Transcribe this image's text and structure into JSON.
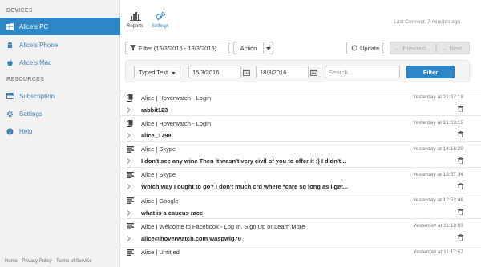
{
  "sidebar": {
    "devices_heading": "DEVICES",
    "devices": [
      {
        "label": "Alice's PC",
        "icon": "windows-icon",
        "active": true
      },
      {
        "label": "Alice's Phone",
        "icon": "android-icon",
        "active": false
      },
      {
        "label": "Alice's Mac",
        "icon": "apple-icon",
        "active": false
      }
    ],
    "resources_heading": "RESOURCES",
    "resources": [
      {
        "label": "Subscription",
        "icon": "card-icon"
      },
      {
        "label": "Settings",
        "icon": "gear-icon"
      },
      {
        "label": "Help",
        "icon": "info-icon"
      }
    ],
    "footer": {
      "home": "Home",
      "sep": "·",
      "privacy": "Privacy Policy",
      "terms": "Terms of Service"
    }
  },
  "topnav": {
    "reports_label": "Reports",
    "settings_label": "Settings",
    "last_connect": "Last Connect: 7 minutes ago"
  },
  "toolbar": {
    "filter_range": "Filter (15/3/2016 - 18/3/2016)",
    "action_label": "Action",
    "update_label": "Update",
    "previous_label": "Previous",
    "next_label": "Next"
  },
  "filter_panel": {
    "type_selected": "Typed Text",
    "date_from": "15/3/2016",
    "date_to": "18/3/2016",
    "search_placeholder": "Search...",
    "filter_label": "Filter"
  },
  "colors": {
    "accent": "#2f86c6",
    "sidebar_bg": "#f2f2f2"
  },
  "entries": [
    {
      "type_icon": "clipboard-icon",
      "title": "Alice | Hoverwatch - Login",
      "time": "Yesterday at 21:07:18",
      "content": "rabbit123"
    },
    {
      "type_icon": "clipboard-icon",
      "title": "Alice | Hoverwatch - Login",
      "time": "Yesterday at 21:03:15",
      "content": "alice_1798"
    },
    {
      "type_icon": "text-lines-icon",
      "title": "Alice | Skype",
      "time": "Yesterday at 14:16:29",
      "content": "I don't see any wine Then it wasn't very civil of you to offer it :) I didn't..."
    },
    {
      "type_icon": "text-lines-icon",
      "title": "Alice | Skype",
      "time": "Yesterday at 13:57:34",
      "content": "Which way I ought to go? I don't much crd where *care so long as I get..."
    },
    {
      "type_icon": "text-lines-icon",
      "title": "Alice | Google",
      "time": "Yesterday at 12:52:46",
      "content": "what is a caucus race"
    },
    {
      "type_icon": "text-lines-icon",
      "title": "Alice | Welcome to Facebook - Log In, Sign Up or Learn More",
      "time": "Yesterday at 11:18:03",
      "content": "alice@hoverwatch.com waspwig70"
    },
    {
      "type_icon": "text-lines-icon",
      "title": "Alice | Untitled",
      "time": "Yesterday at 11:17:57",
      "content": ""
    }
  ]
}
